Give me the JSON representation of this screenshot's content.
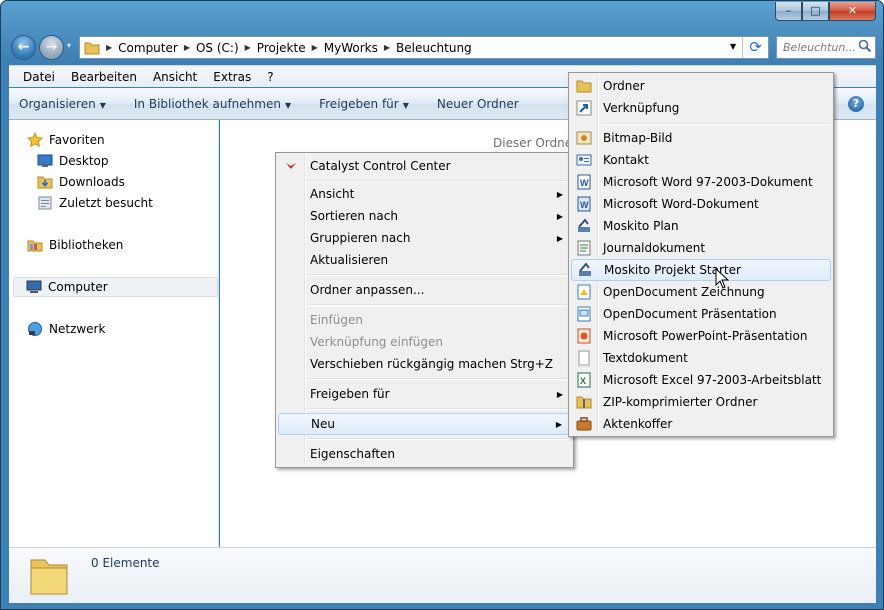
{
  "window": {
    "minimize_glyph": "–",
    "maximize_glyph": "□",
    "close_glyph": "✕"
  },
  "nav": {
    "back_glyph": "←",
    "forward_glyph": "→",
    "recent_glyph": "▾",
    "breadcrumbs": [
      "Computer",
      "OS (C:)",
      "Projekte",
      "MyWorks",
      "Beleuchtung"
    ],
    "refresh_glyph": "⟳",
    "search_placeholder": "Beleuchtun..."
  },
  "menubar": [
    "Datei",
    "Bearbeiten",
    "Ansicht",
    "Extras",
    "?"
  ],
  "commandbar": {
    "organize": "Organisieren",
    "library": "In Bibliothek aufnehmen",
    "share": "Freigeben für",
    "new_folder": "Neuer Ordner",
    "help_glyph": "?"
  },
  "navpane": {
    "favorites": "Favoriten",
    "desktop": "Desktop",
    "downloads": "Downloads",
    "recent": "Zuletzt besucht",
    "libraries": "Bibliotheken",
    "computer": "Computer",
    "network": "Netzwerk"
  },
  "content": {
    "empty_text": "Dieser Ordner"
  },
  "details": {
    "count": "0 Elemente"
  },
  "context_menu": {
    "catalyst": "Catalyst Control Center",
    "view": "Ansicht",
    "sort": "Sortieren nach",
    "group": "Gruppieren nach",
    "refresh": "Aktualisieren",
    "customize": "Ordner anpassen...",
    "paste": "Einfügen",
    "paste_shortcut": "Verknüpfung einfügen",
    "undo_move": "Verschieben rückgängig machen",
    "undo_accel": "Strg+Z",
    "share": "Freigeben für",
    "new": "Neu",
    "properties": "Eigenschaften",
    "arrow_glyph": "▶"
  },
  "new_submenu": {
    "folder": "Ordner",
    "shortcut": "Verknüpfung",
    "bitmap": "Bitmap-Bild",
    "contact": "Kontakt",
    "word97": "Microsoft Word 97-2003-Dokument",
    "word": "Microsoft Word-Dokument",
    "moskito_plan": "Moskito Plan",
    "journal": "Journaldokument",
    "moskito_starter": "Moskito Projekt Starter",
    "odg": "OpenDocument Zeichnung",
    "odp": "OpenDocument Präsentation",
    "ppt": "Microsoft PowerPoint-Präsentation",
    "text": "Textdokument",
    "excel97": "Microsoft Excel 97-2003-Arbeitsblatt",
    "zip": "ZIP-komprimierter Ordner",
    "briefcase": "Aktenkoffer"
  }
}
